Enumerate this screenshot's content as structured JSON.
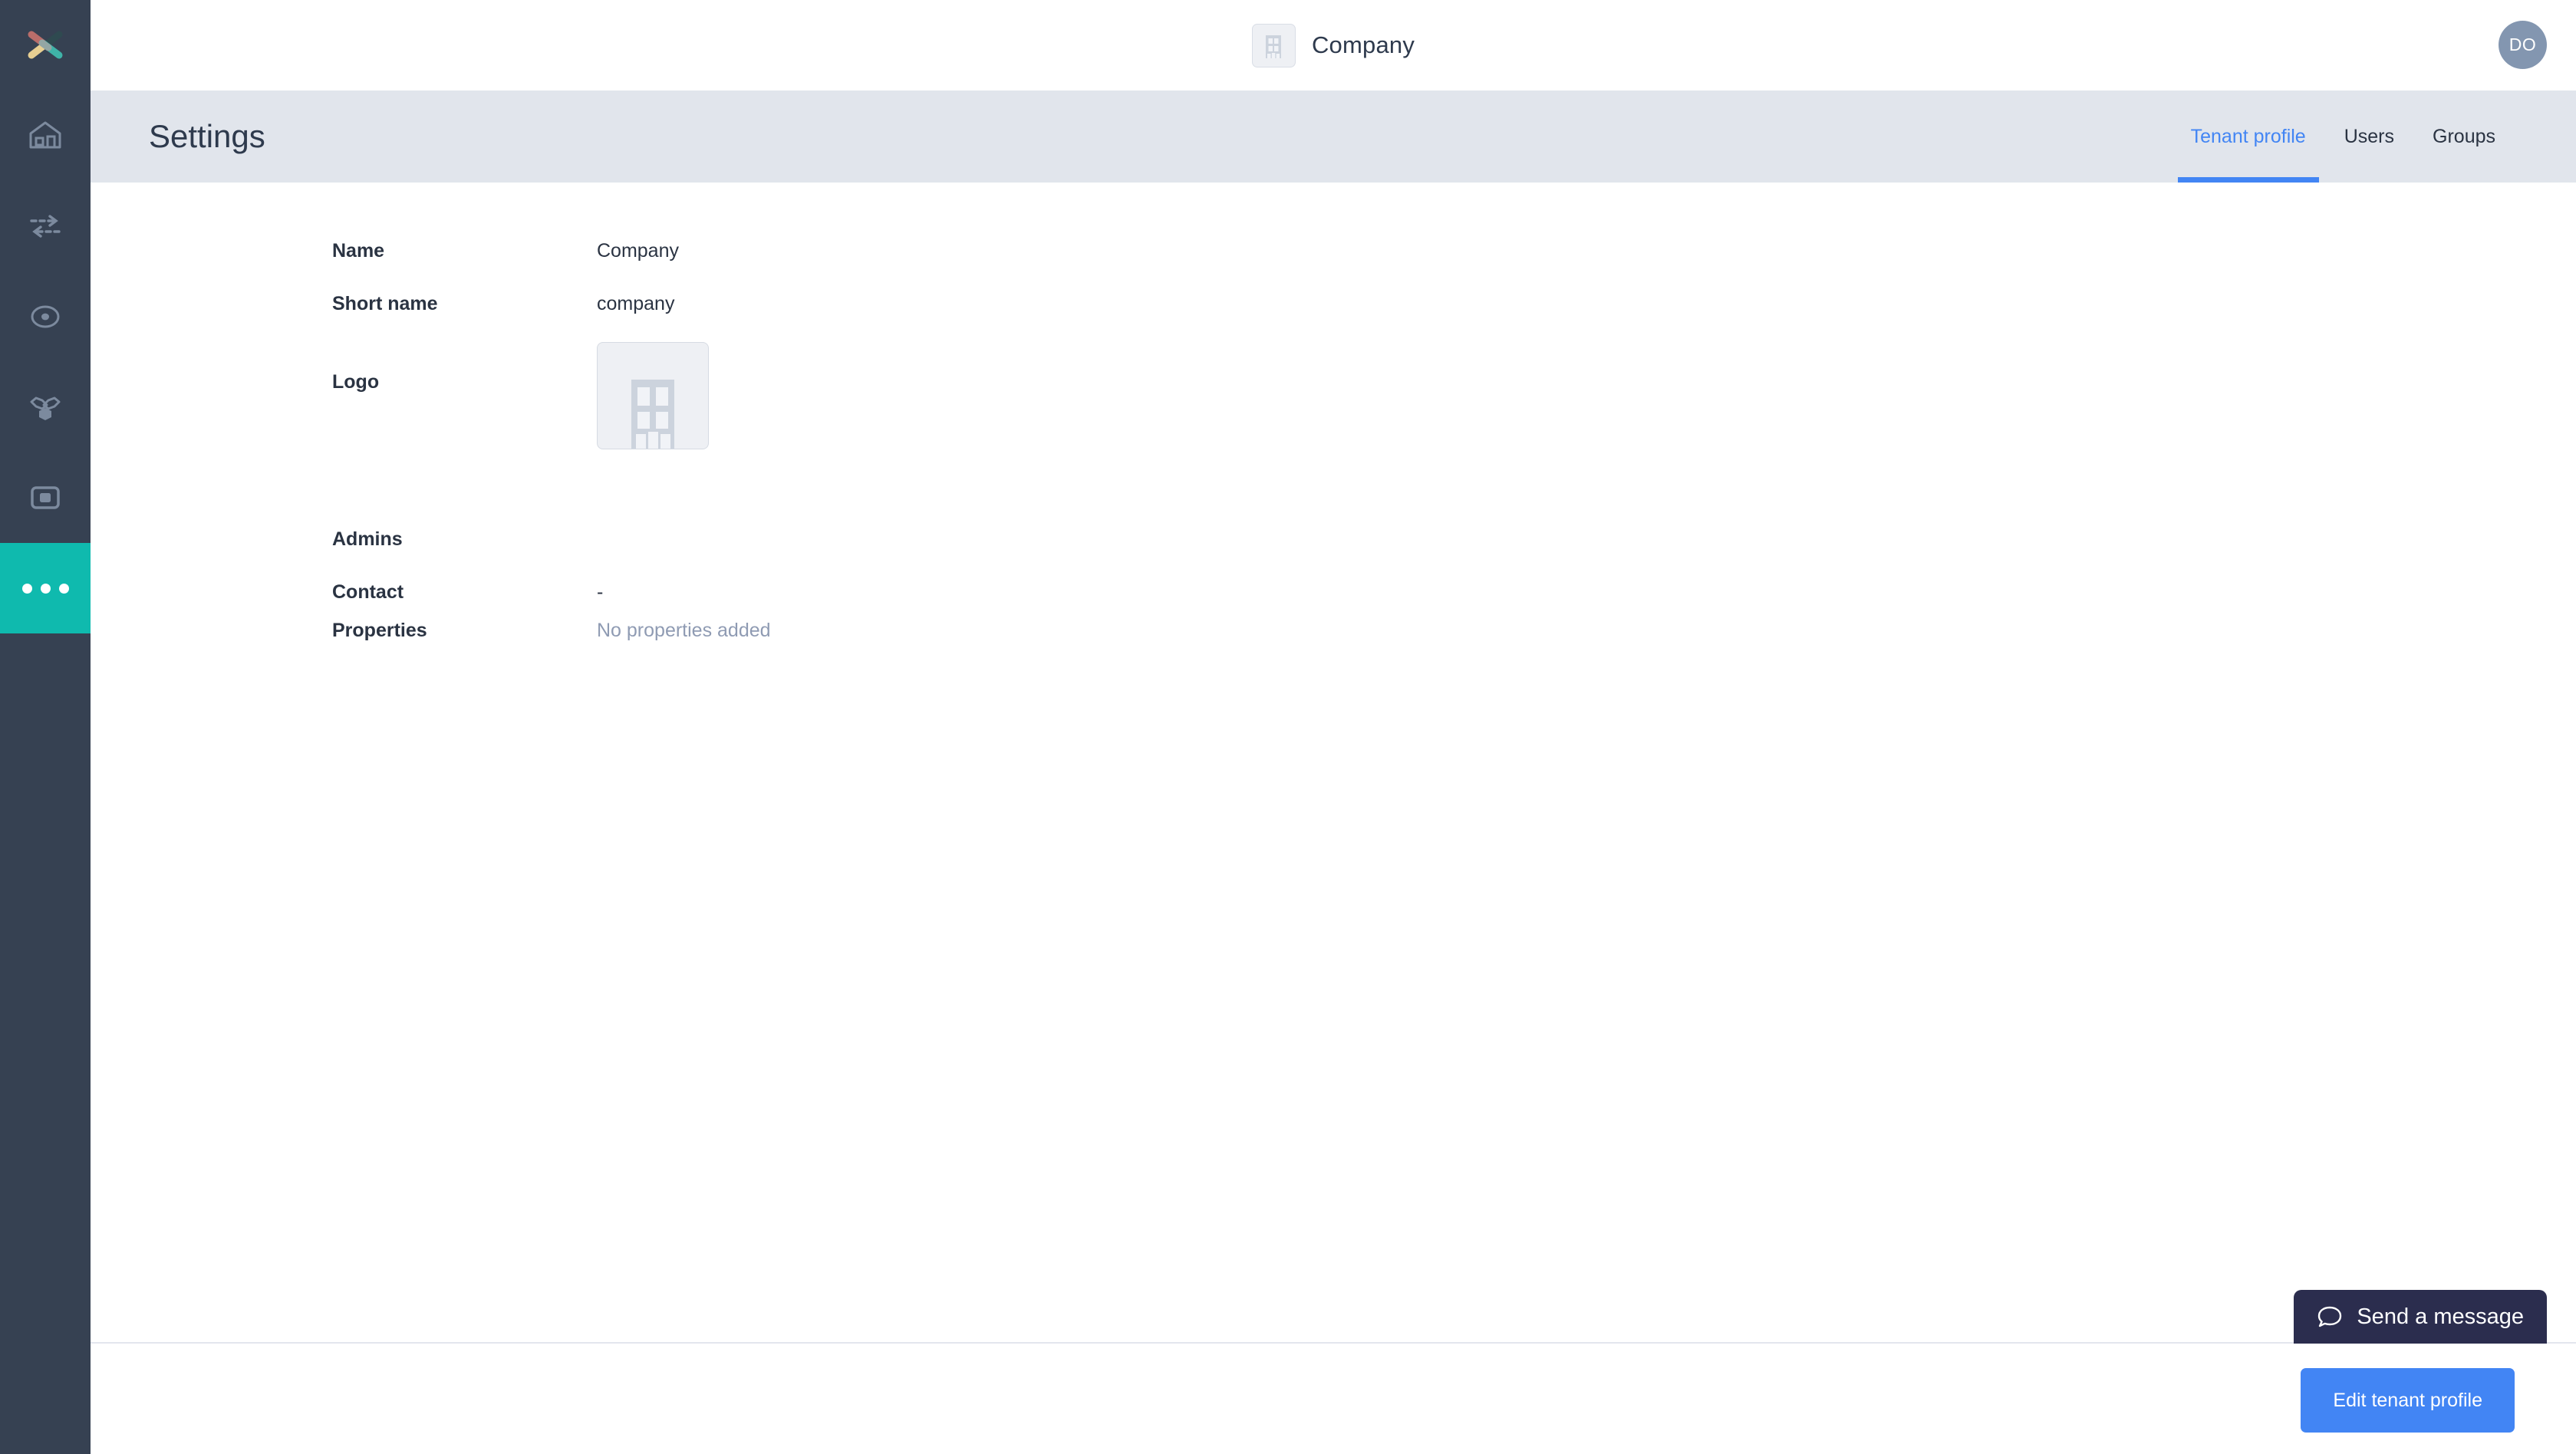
{
  "sidebar": {
    "brand_icon": "x-logo-icon",
    "items": [
      {
        "name": "home",
        "icon": "home-icon",
        "active": false
      },
      {
        "name": "transfers",
        "icon": "bidirectional-arrows-icon",
        "active": false
      },
      {
        "name": "monitor",
        "icon": "target-circle-icon",
        "active": false
      },
      {
        "name": "network",
        "icon": "hexagon-nodes-icon",
        "active": false
      },
      {
        "name": "device",
        "icon": "square-in-square-icon",
        "active": false
      },
      {
        "name": "more",
        "icon": "ellipsis-icon",
        "active": true
      }
    ]
  },
  "header": {
    "tenant_icon": "building-icon",
    "tenant_name": "Company",
    "avatar_initials": "DO"
  },
  "settings": {
    "title": "Settings",
    "tabs": [
      {
        "label": "Tenant profile",
        "active": true
      },
      {
        "label": "Users",
        "active": false
      },
      {
        "label": "Groups",
        "active": false
      }
    ]
  },
  "profile": {
    "fields": {
      "name_label": "Name",
      "name_value": "Company",
      "short_name_label": "Short name",
      "short_name_value": "company",
      "logo_label": "Logo",
      "logo_icon": "building-icon",
      "admins_label": "Admins",
      "admins_value": "",
      "contact_label": "Contact",
      "contact_value": "-",
      "properties_label": "Properties",
      "properties_value": "No properties added"
    }
  },
  "footer": {
    "edit_button": "Edit tenant profile"
  },
  "chat": {
    "icon": "speech-bubble-icon",
    "label": "Send a message"
  },
  "colors": {
    "sidebar_bg": "#364152",
    "sidebar_active": "#0fbaae",
    "accent_blue": "#4285f4",
    "settings_bar": "#e1e5ec",
    "chat_bg": "#2b2d4e",
    "muted_text": "#8f9bb3"
  }
}
